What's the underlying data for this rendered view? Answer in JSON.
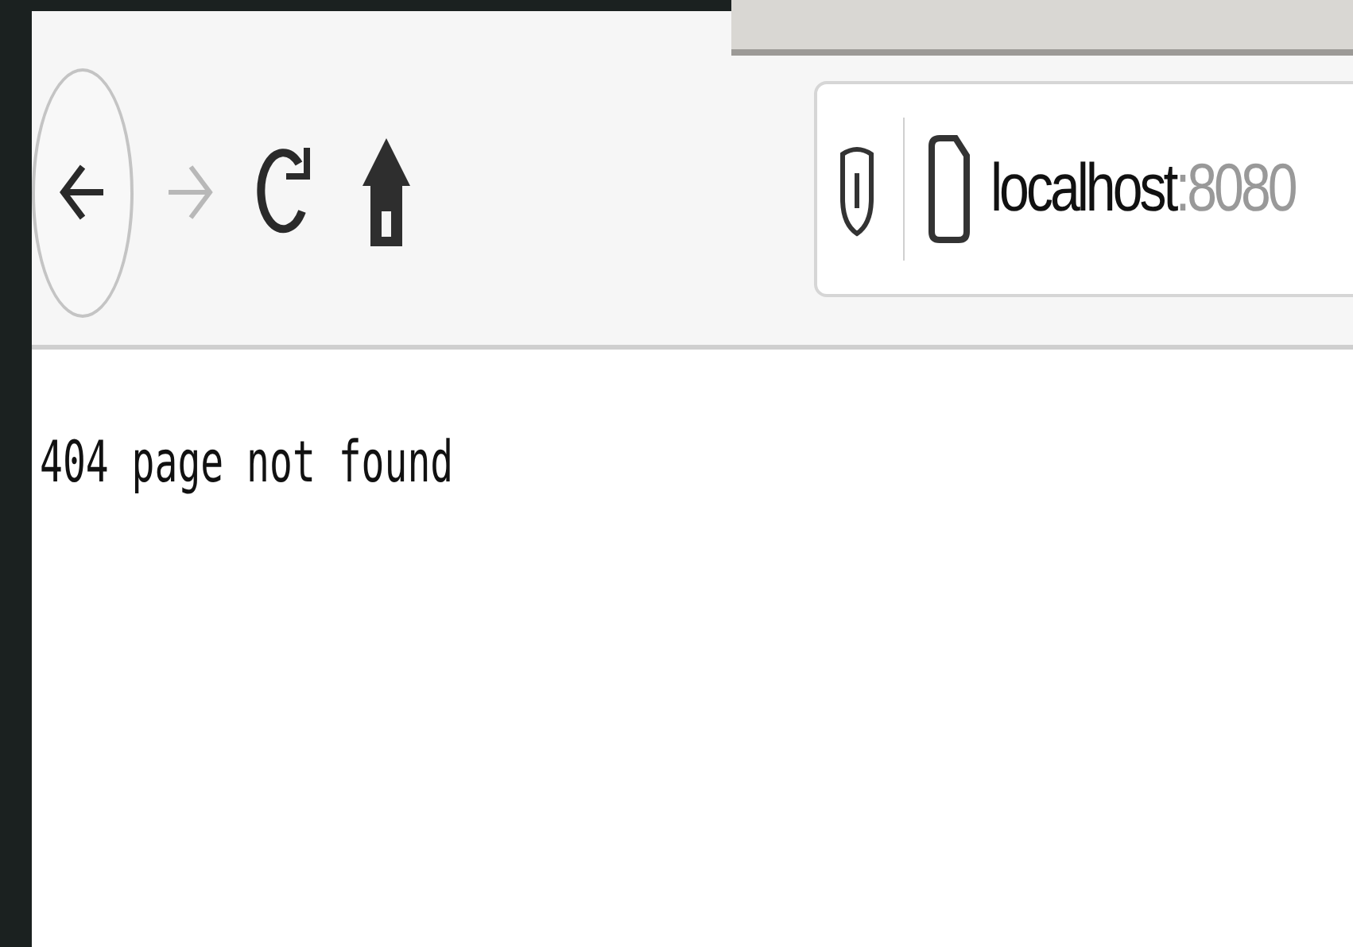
{
  "toolbar": {
    "back": {
      "disabled": false
    },
    "forward": {
      "disabled": true
    }
  },
  "address_bar": {
    "host": "localhost",
    "port": ":8080"
  },
  "page": {
    "message": "404 page not found"
  }
}
